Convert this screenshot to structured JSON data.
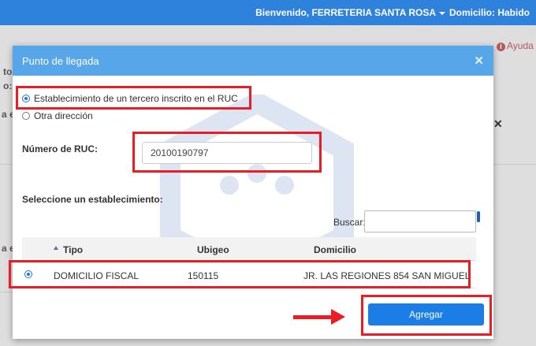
{
  "header": {
    "welcome": "Bienvenido, FERRETERIA SANTA ROSA",
    "domicilio": "Domicilio: Habido"
  },
  "background": {
    "frag_to": "to",
    "frag_o": "o:",
    "frag_ae1": "a e",
    "frag_ae2": "a e",
    "ayuda": "Ayuda",
    "close_glyph": "✕"
  },
  "modal": {
    "title": "Punto de llegada",
    "close_glyph": "✕",
    "options": [
      {
        "label": "Establecimiento de un tercero inscrito en el RUC",
        "checked": true
      },
      {
        "label": "Otra dirección",
        "checked": false
      }
    ],
    "ruc_label": "Número de RUC:",
    "ruc_value": "20100190797",
    "select_label": "Seleccione un establecimiento:",
    "search_label": "Buscar:",
    "table": {
      "columns": [
        "Tipo",
        "Ubigeo",
        "Domicilio"
      ],
      "rows": [
        {
          "selected": true,
          "tipo": "DOMICILIO FISCAL",
          "ubigeo": "150115",
          "domicilio": "JR. LAS REGIONES 854 SAN MIGUEL"
        }
      ]
    },
    "add_button": "Agregar"
  },
  "colors": {
    "header_bg": "#2f82dc",
    "modal_header_bg": "#58a6ea",
    "primary_button": "#1a7ee6",
    "annotation_red": "#ec1c24"
  }
}
